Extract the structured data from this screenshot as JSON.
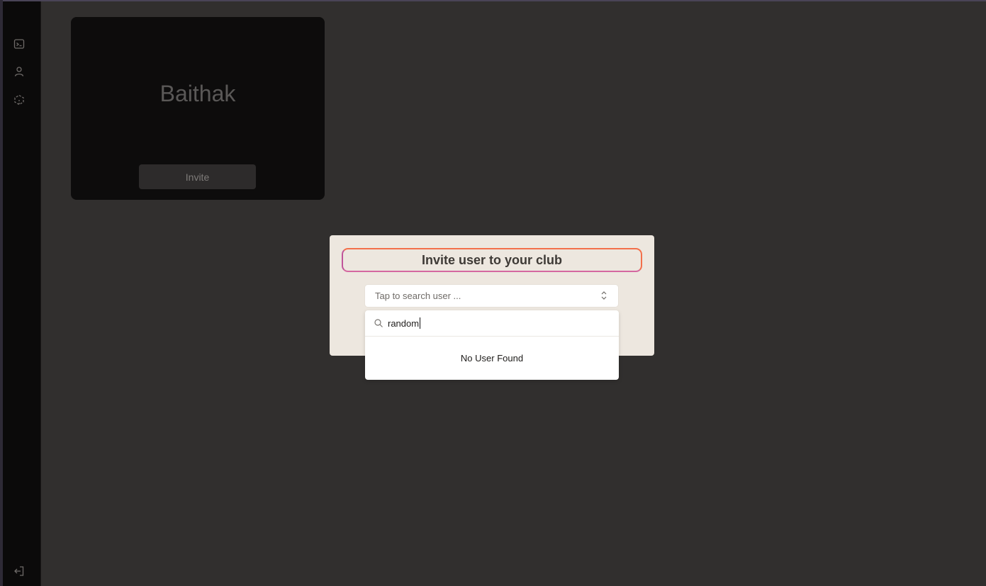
{
  "sidebar": {
    "icons": [
      "terminal-icon",
      "user-icon",
      "box-icon"
    ],
    "logout_icon": "logout-icon"
  },
  "club_card": {
    "title": "Baithak",
    "invite_label": "Invite"
  },
  "modal": {
    "title": "Invite user to your club",
    "select_placeholder": "Tap to search user ...",
    "search_value": "random",
    "empty_message": "No User Found"
  },
  "colors": {
    "title_border_start": "#c0559a",
    "title_border_end": "#f36f4a",
    "modal_bg": "#ede7df"
  }
}
